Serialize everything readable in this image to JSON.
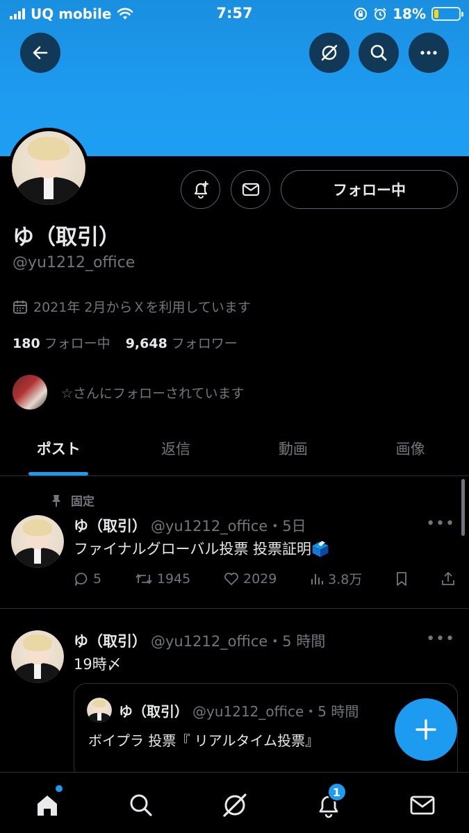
{
  "status_bar": {
    "carrier": "UQ mobile",
    "time": "7:57",
    "battery": "18%",
    "battery_level": 0.18
  },
  "profile": {
    "name": "ゆ（取引）",
    "handle": "@yu1212_office",
    "joined": "2021年 2月からＸを利用しています",
    "following_count": "180",
    "following_label": "フォロー中",
    "followers_count": "9,648",
    "followers_label": "フォロワー",
    "followed_by": "☆さんにフォローされています",
    "follow_button": "フォロー中"
  },
  "tabs": [
    {
      "label": "ポスト",
      "active": true
    },
    {
      "label": "返信",
      "active": false
    },
    {
      "label": "動画",
      "active": false
    },
    {
      "label": "画像",
      "active": false
    }
  ],
  "posts": [
    {
      "pinned_label": "固定",
      "name": "ゆ（取引）",
      "handle": "@yu1212_office",
      "time": "・5日",
      "text": "ファイナルグローバル投票 投票証明🗳️",
      "replies": "5",
      "reposts": "1945",
      "likes": "2029",
      "views": "3.8万"
    },
    {
      "name": "ゆ（取引）",
      "handle": "@yu1212_office",
      "time": "・5 時間",
      "text": "19時〆",
      "quote": {
        "name": "ゆ（取引）",
        "handle": "@yu1212_office",
        "time": "・5 時間",
        "text": "ボイプラ 投票『 リアルタイム投票』"
      }
    }
  ],
  "nav": {
    "notifications_badge": "1"
  },
  "icons": {
    "back": "back-arrow-icon",
    "grok": "grok-icon",
    "search": "search-icon",
    "more": "more-icon",
    "notify": "bell-plus-icon",
    "message": "envelope-icon"
  },
  "colors": {
    "accent": "#1d9bf0",
    "muted": "#71767b",
    "text": "#e7e9ea",
    "divider": "#2f3336"
  }
}
